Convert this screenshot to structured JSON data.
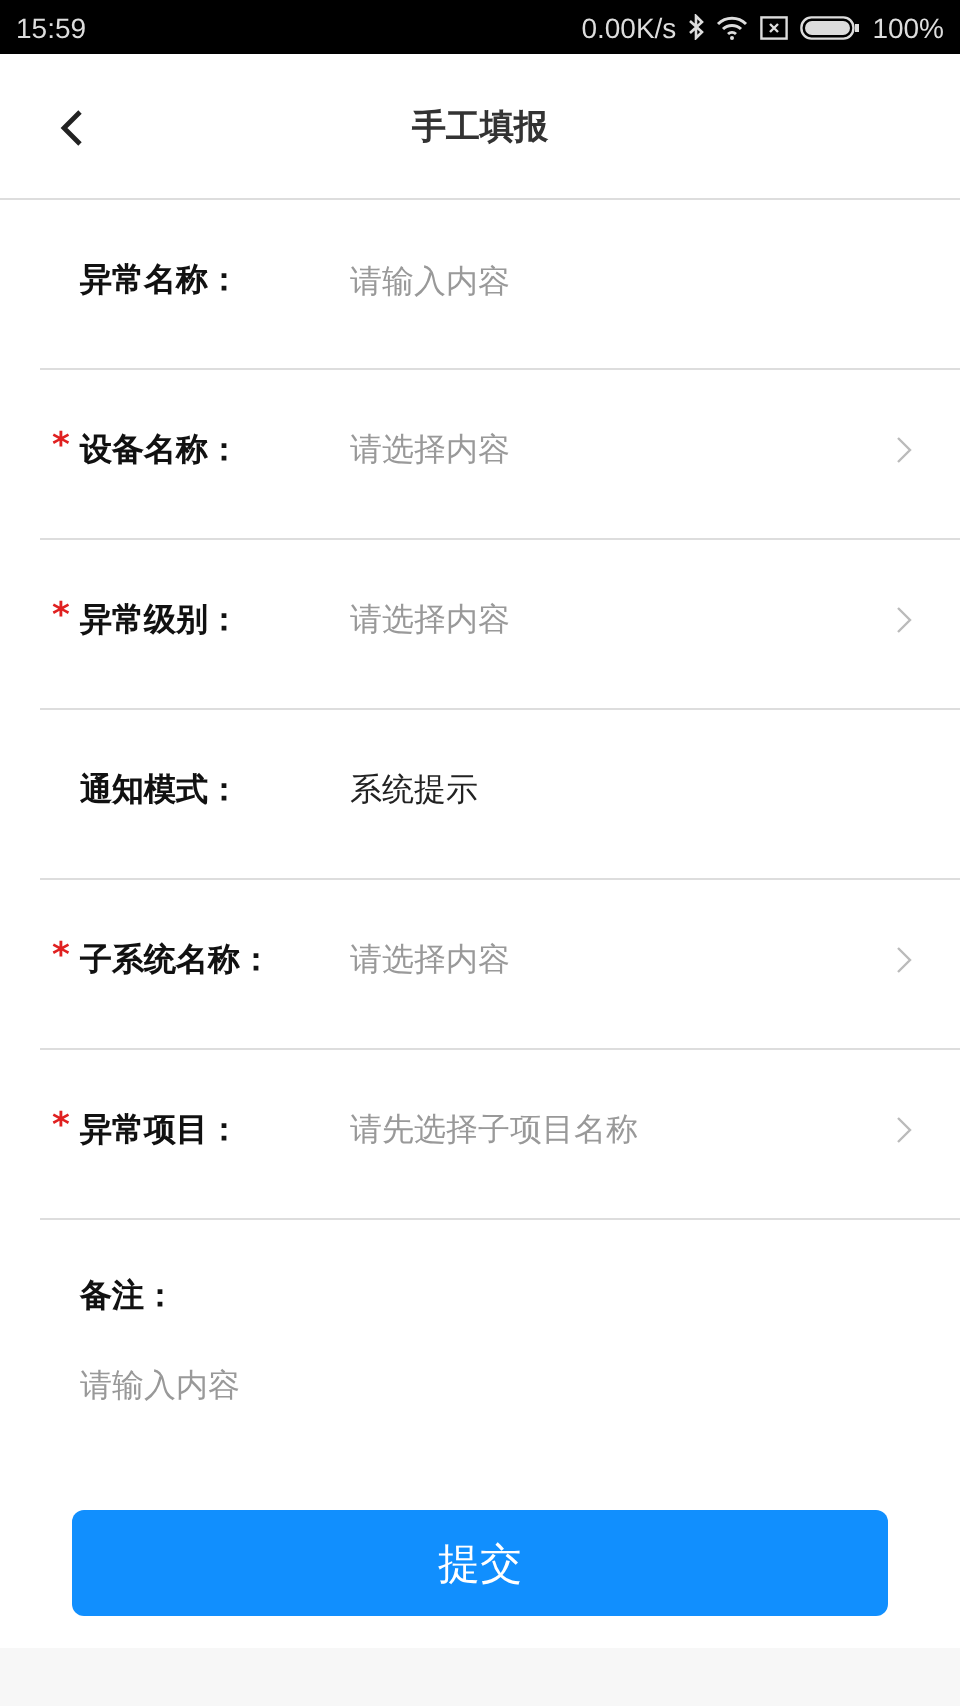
{
  "status_bar": {
    "time": "15:59",
    "net_speed": "0.00K/s",
    "battery": "100%"
  },
  "header": {
    "title": "手工填报"
  },
  "fields": [
    {
      "label": "异常名称：",
      "kind": "input",
      "placeholder": "请输入内容"
    },
    {
      "label": "设备名称：",
      "required_mark": "*",
      "kind": "select",
      "placeholder": "请选择内容"
    },
    {
      "label": "异常级别：",
      "required_mark": "*",
      "kind": "select",
      "placeholder": "请选择内容"
    },
    {
      "label": "通知模式：",
      "kind": "text",
      "value": "系统提示"
    },
    {
      "label": "子系统名称：",
      "required_mark": "*",
      "kind": "select",
      "placeholder": "请选择内容"
    },
    {
      "label": "异常项目：",
      "required_mark": "*",
      "kind": "select",
      "placeholder": "请先选择子项目名称"
    }
  ],
  "remark": {
    "label": "备注：",
    "placeholder": "请输入内容"
  },
  "submit_button": {
    "label": "提交"
  }
}
